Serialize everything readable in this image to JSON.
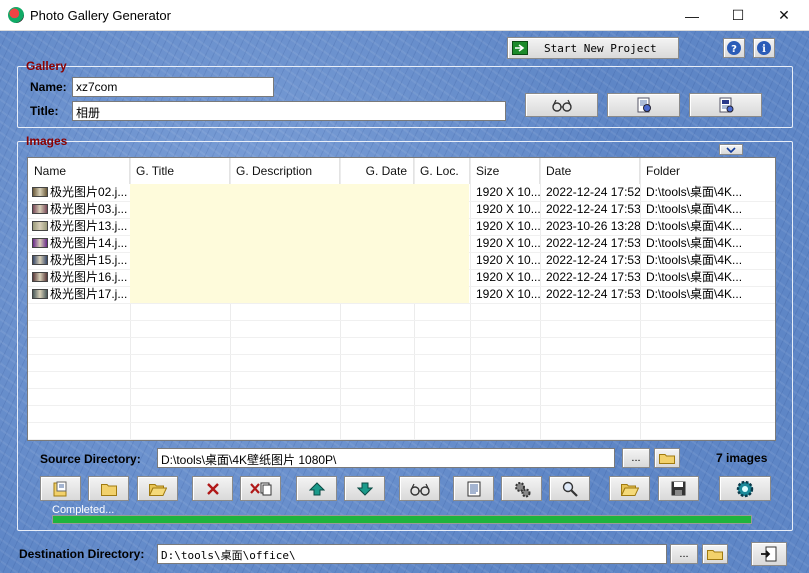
{
  "window": {
    "title": "Photo Gallery Generator",
    "minimize": "—",
    "maximize": "☐",
    "close": "✕"
  },
  "toolbar": {
    "start_new_project": "Start New Project"
  },
  "gallery": {
    "section": "Gallery",
    "name_label": "Name:",
    "name_value": "xz7com",
    "title_label": "Title:",
    "title_value": "相册"
  },
  "images": {
    "section": "Images",
    "columns": [
      "Name",
      "G. Title",
      "G. Description",
      "G. Date",
      "G. Loc.",
      "Size",
      "Date",
      "Folder"
    ],
    "rows": [
      {
        "name": "极光图片02.j...",
        "size": "1920 X 10...",
        "date": "2022-12-24 17:52",
        "folder": "D:\\tools\\桌面\\4K...",
        "thumb": "#6a5a3a"
      },
      {
        "name": "极光图片03.j...",
        "size": "1920 X 10...",
        "date": "2022-12-24 17:53",
        "folder": "D:\\tools\\桌面\\4K...",
        "thumb": "#7a4a5a"
      },
      {
        "name": "极光图片13.j...",
        "size": "1920 X 10...",
        "date": "2023-10-26 13:28",
        "folder": "D:\\tools\\桌面\\4K...",
        "thumb": "#9a9a7a"
      },
      {
        "name": "极光图片14.j...",
        "size": "1920 X 10...",
        "date": "2022-12-24 17:53",
        "folder": "D:\\tools\\桌面\\4K...",
        "thumb": "#6a2a8a"
      },
      {
        "name": "极光图片15.j...",
        "size": "1920 X 10...",
        "date": "2022-12-24 17:53",
        "folder": "D:\\tools\\桌面\\4K...",
        "thumb": "#3a4a6a"
      },
      {
        "name": "极光图片16.j...",
        "size": "1920 X 10...",
        "date": "2022-12-24 17:53",
        "folder": "D:\\tools\\桌面\\4K...",
        "thumb": "#5a3a3a"
      },
      {
        "name": "极光图片17.j...",
        "size": "1920 X 10...",
        "date": "2022-12-24 17:53",
        "folder": "D:\\tools\\桌面\\4K...",
        "thumb": "#4a5a5a"
      }
    ]
  },
  "source": {
    "label": "Source Directory:",
    "value": "D:\\tools\\桌面\\4K壁纸图片 1080P\\",
    "browse": "...",
    "count": "7 images"
  },
  "status": {
    "text": "Completed...",
    "progress": 1.0
  },
  "destination": {
    "label": "Destination Directory:",
    "value": "D:\\tools\\桌面\\office\\",
    "browse": "..."
  },
  "colors": {
    "background": "#5e86c6",
    "section_title": "#8b0000",
    "progress": "#1fb43d",
    "gallery_cell": "#fefbdb"
  },
  "icons": [
    "help-icon",
    "info-icon",
    "preview-icon",
    "settings-icon",
    "generate-icon",
    "add-files-icon",
    "add-folder-icon",
    "open-folder-icon",
    "delete-icon",
    "delete-all-icon",
    "move-up-icon",
    "move-down-icon",
    "preview-images-icon",
    "edit-icon",
    "gear-icon",
    "search-icon",
    "folder-icon",
    "save-icon",
    "generate-gallery-icon",
    "exit-icon",
    "collapse-icon"
  ]
}
